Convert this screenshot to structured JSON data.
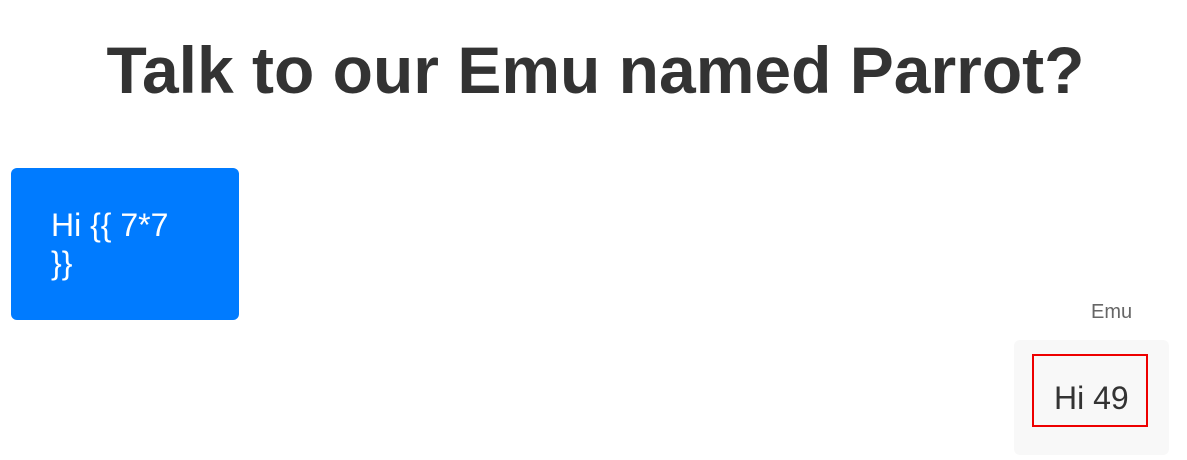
{
  "header": {
    "title": "Talk to our Emu named Parrot?"
  },
  "chat": {
    "user_message": "Hi {{ 7*7\n}}",
    "bot_sender": "Emu",
    "bot_message": "Hi 49"
  },
  "colors": {
    "user_bubble": "#007bff",
    "bot_bubble": "#f8f8f8",
    "highlight": "#ee0000",
    "title_text": "#333333"
  }
}
